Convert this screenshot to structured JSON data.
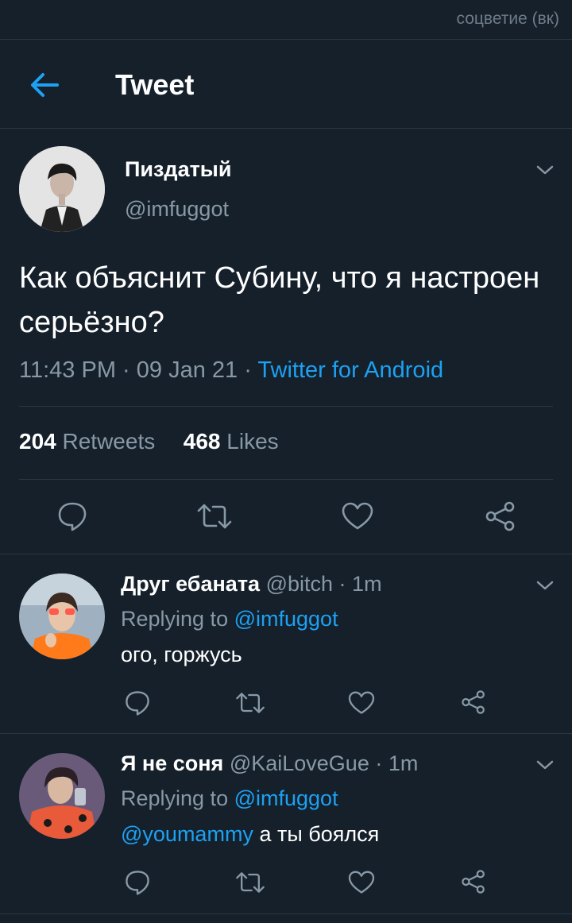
{
  "watermark": "соцветие (вк)",
  "header": {
    "title": "Tweet"
  },
  "tweet": {
    "name": "Пиздатый",
    "handle": "@imfuggot",
    "text": "Как объяснит Субину, что я настроен серьёзно?",
    "time": "11:43 PM",
    "date": "09 Jan 21",
    "source": "Twitter for Android",
    "retweets_count": "204",
    "retweets_label": "Retweets",
    "likes_count": "468",
    "likes_label": "Likes"
  },
  "replies": [
    {
      "name": "Друг ебаната",
      "handle": "@bitch",
      "time": "1m",
      "replying_prefix": "Replying to",
      "replying_to": "@imfuggot",
      "mention": "",
      "text": "ого, горжусь"
    },
    {
      "name": "Я не соня",
      "handle": "@KaiLoveGue",
      "time": "1m",
      "replying_prefix": "Replying to",
      "replying_to": "@imfuggot",
      "mention": "@youmammy",
      "text": "а ты боялся"
    }
  ],
  "colors": {
    "background": "#15202b",
    "accent": "#1da1f2",
    "secondary_text": "#8899a6",
    "divider": "#2b3742"
  },
  "icons": [
    "back-arrow-icon",
    "chevron-down-icon",
    "reply-icon",
    "retweet-icon",
    "like-icon",
    "share-icon"
  ]
}
